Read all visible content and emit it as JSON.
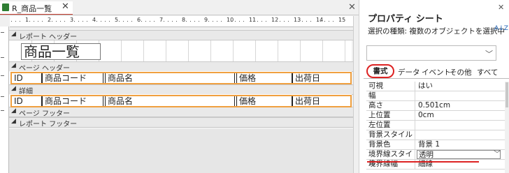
{
  "document_tab": {
    "title": "R_商品一覧",
    "close_glyph": "✕"
  },
  "window_close_glyph": "✕",
  "ruler": {
    "numbers": [
      "1",
      "2",
      "3",
      "4",
      "5",
      "6",
      "7",
      "8",
      "9",
      "10",
      "11",
      "12",
      "13",
      "14",
      "15"
    ]
  },
  "sections": {
    "report_header": "レポート ヘッダー",
    "page_header": "ページ ヘッダー",
    "detail": "詳細",
    "page_footer": "ページ フッター",
    "report_footer": "レポート フッター"
  },
  "report_title": "商品一覧",
  "page_header_labels": [
    "ID",
    "商品コード",
    "商品名",
    "価格",
    "出荷日"
  ],
  "detail_fields": [
    "ID",
    "商品コード",
    "商品名",
    "価格",
    "出荷日"
  ],
  "property_sheet": {
    "title": "プロパティ シート",
    "close_glyph": "✕",
    "selection_type": "選択の種類:  複数のオブジェクトを選択中",
    "sort_icon_text": "A↓Z",
    "tabs": [
      "書式",
      "データ",
      "イベント",
      "その他",
      "すべて"
    ],
    "properties": [
      {
        "name": "可視",
        "value": "はい"
      },
      {
        "name": "幅",
        "value": ""
      },
      {
        "name": "高さ",
        "value": "0.501cm"
      },
      {
        "name": "上位置",
        "value": "0cm"
      },
      {
        "name": "左位置",
        "value": ""
      },
      {
        "name": "背景スタイル",
        "value": ""
      },
      {
        "name": "背景色",
        "value": "背景 1"
      },
      {
        "name": "境界線スタイル",
        "value": "透明"
      },
      {
        "name": "境界線幅",
        "value": "細線"
      }
    ]
  },
  "colors": {
    "selection": "#f0a040",
    "highlight_red": "#d22222",
    "tab_underline": "#c0392b"
  }
}
